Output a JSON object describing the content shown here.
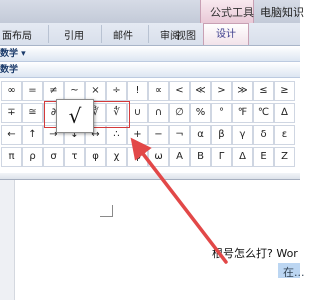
{
  "window": {
    "contextual_group": "公式工具",
    "title_fragment": "电脑知识"
  },
  "tabs": [
    {
      "label": "面布局"
    },
    {
      "label": "引用"
    },
    {
      "label": "邮件"
    },
    {
      "label": "审阅"
    },
    {
      "label": "视图"
    },
    {
      "label": "设计",
      "selected": true
    }
  ],
  "sections": {
    "primary": "数学 ▾",
    "secondary": "数学"
  },
  "symbols": [
    [
      "∞",
      "=",
      "≠",
      "~",
      "×",
      "÷",
      "!",
      "∝",
      "<",
      "≪",
      ">",
      "≫",
      "≤",
      "≥"
    ],
    [
      "∓",
      "≅",
      "∂",
      "√",
      "∛",
      "∜",
      "∪",
      "∩",
      "∅",
      "%",
      "°",
      "℉",
      "℃",
      "∆"
    ],
    [
      "←",
      "↑",
      "→",
      "↓",
      "↔",
      "∴",
      "+",
      "−",
      "¬",
      "α",
      "β",
      "γ",
      "δ",
      "ε"
    ],
    [
      "π",
      "ρ",
      "σ",
      "τ",
      "φ",
      "χ",
      "ψ",
      "ω",
      "Α",
      "Β",
      "Γ",
      "Δ",
      "Ε",
      "Ζ"
    ]
  ],
  "popup_symbol": "√",
  "document": {
    "line1": "根号怎么打? Wor",
    "line2": "在..."
  },
  "colors": {
    "highlight": "#d43a3a",
    "arrow": "#e24848",
    "selection": "#bcd6f2"
  }
}
